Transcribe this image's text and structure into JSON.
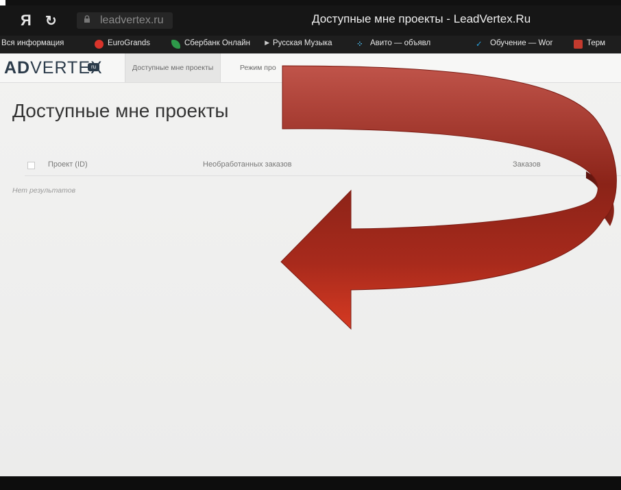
{
  "browser": {
    "logo": "Я",
    "reload_glyph": "↻",
    "lock_glyph": "🔒",
    "address": "leadvertex.ru",
    "window_title": "Доступные мне проекты - LeadVertex.Ru"
  },
  "bookmarks": [
    {
      "label": "Вся информация",
      "icon": "none"
    },
    {
      "label": "EuroGrands",
      "icon": "red-circle"
    },
    {
      "label": "Сбербанк Онлайн",
      "icon": "green-leaf"
    },
    {
      "label": "Русская Музыка",
      "icon": "play-arrow"
    },
    {
      "label": "Авито — объявл",
      "icon": "avito-dots"
    },
    {
      "label": "Обучение — Wor",
      "icon": "blue-check"
    },
    {
      "label": "Терм",
      "icon": "red-square"
    }
  ],
  "site": {
    "logo_ad": "AD",
    "logo_vertex": "VERTEX",
    "logo_badge": "ru",
    "tabs": [
      "Доступные мне проекты",
      "Режим про"
    ]
  },
  "main": {
    "title": "Доступные мне проекты",
    "columns": [
      "Проект (ID)",
      "Необработанных заказов",
      "Заказов"
    ],
    "empty": "Нет результатов"
  },
  "colors": {
    "arrow_light": "#c0392b",
    "arrow_dark": "#7a1a12",
    "logo": "#2b3b4a"
  }
}
